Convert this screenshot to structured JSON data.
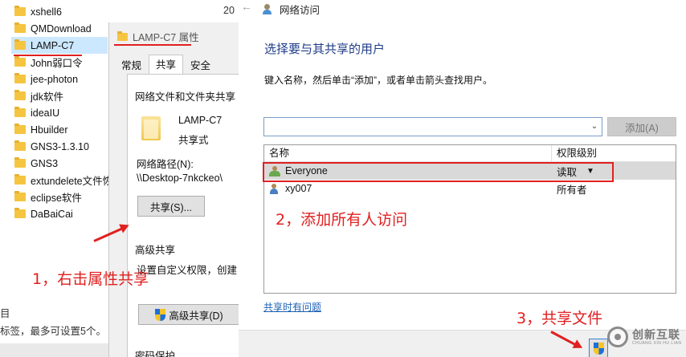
{
  "explorer": {
    "items": [
      {
        "label": "xshell6"
      },
      {
        "label": "QMDownload"
      },
      {
        "label": "LAMP-C7",
        "selected": true
      },
      {
        "label": "John弱口令"
      },
      {
        "label": "jee-photon"
      },
      {
        "label": "jdk软件"
      },
      {
        "label": "ideaIU"
      },
      {
        "label": "Hbuilder"
      },
      {
        "label": "GNS3-1.3.10"
      },
      {
        "label": "GNS3"
      },
      {
        "label": "extundelete文件恢复"
      },
      {
        "label": "eclipse软件"
      },
      {
        "label": "DaBaiCai"
      }
    ],
    "date_fragment": "20",
    "bottom_line1": "目",
    "bottom_line2": "标签，最多可设置5个。"
  },
  "properties": {
    "title": "LAMP-C7 属性",
    "tabs": [
      "常规",
      "共享",
      "安全"
    ],
    "active_tab": 1,
    "section_network": "网络文件和文件夹共享",
    "folder_name": "LAMP-C7",
    "folder_status": "共享式",
    "path_label": "网络路径(N):",
    "path_value": "\\\\Desktop-7nkckeo\\",
    "share_button": "共享(S)...",
    "section_advanced": "高级共享",
    "advanced_desc": "设置自定义权限，创建",
    "advanced_button": "高级共享(D)",
    "section_password": "密码保护"
  },
  "wizard": {
    "window_title": "网络访问",
    "heading": "选择要与其共享的用户",
    "instruction": "键入名称，然后单击“添加”，或者单击箭头查找用户。",
    "input_value": "",
    "add_button": "添加(A)",
    "columns": [
      "名称",
      "权限级别"
    ],
    "rows": [
      {
        "name": "Everyone",
        "permission": "读取",
        "selected": true,
        "icon": "group-icon"
      },
      {
        "name": "xy007",
        "permission": "所有者",
        "selected": false,
        "icon": "user-icon"
      }
    ],
    "help_link": "共享时有问题"
  },
  "annotations": {
    "step1": "1，右击属性共享",
    "step2": "2，添加所有人访问",
    "step3": "3，共享文件"
  },
  "watermark": {
    "main": "创新互联",
    "sub": "CHUANG XIN HU LIAN"
  },
  "colors": {
    "annotation_red": "#e02020",
    "heading_blue": "#1f3c88",
    "link_blue": "#1a5fb4",
    "selection_blue": "#cce8ff"
  }
}
